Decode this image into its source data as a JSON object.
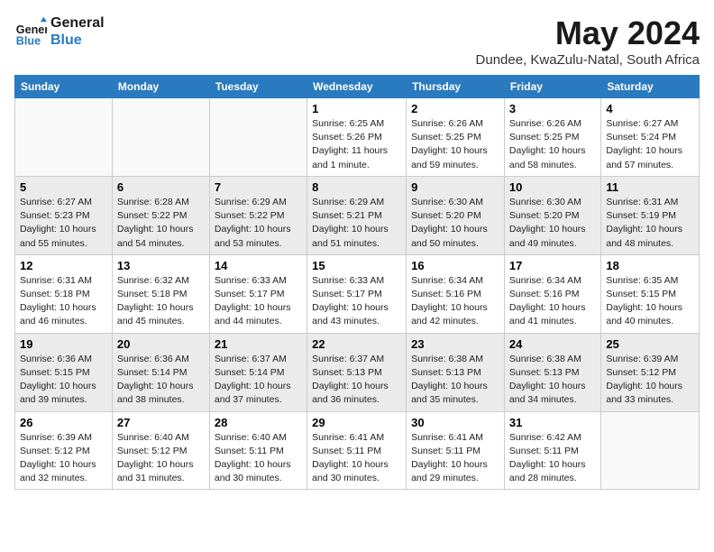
{
  "logo": {
    "line1": "General",
    "line2": "Blue"
  },
  "title": "May 2024",
  "subtitle": "Dundee, KwaZulu-Natal, South Africa",
  "days_of_week": [
    "Sunday",
    "Monday",
    "Tuesday",
    "Wednesday",
    "Thursday",
    "Friday",
    "Saturday"
  ],
  "weeks": [
    [
      {
        "num": "",
        "sunrise": "",
        "sunset": "",
        "daylight": ""
      },
      {
        "num": "",
        "sunrise": "",
        "sunset": "",
        "daylight": ""
      },
      {
        "num": "",
        "sunrise": "",
        "sunset": "",
        "daylight": ""
      },
      {
        "num": "1",
        "sunrise": "6:25 AM",
        "sunset": "5:26 PM",
        "daylight": "11 hours and 1 minute."
      },
      {
        "num": "2",
        "sunrise": "6:26 AM",
        "sunset": "5:25 PM",
        "daylight": "10 hours and 59 minutes."
      },
      {
        "num": "3",
        "sunrise": "6:26 AM",
        "sunset": "5:25 PM",
        "daylight": "10 hours and 58 minutes."
      },
      {
        "num": "4",
        "sunrise": "6:27 AM",
        "sunset": "5:24 PM",
        "daylight": "10 hours and 57 minutes."
      }
    ],
    [
      {
        "num": "5",
        "sunrise": "6:27 AM",
        "sunset": "5:23 PM",
        "daylight": "10 hours and 55 minutes."
      },
      {
        "num": "6",
        "sunrise": "6:28 AM",
        "sunset": "5:22 PM",
        "daylight": "10 hours and 54 minutes."
      },
      {
        "num": "7",
        "sunrise": "6:29 AM",
        "sunset": "5:22 PM",
        "daylight": "10 hours and 53 minutes."
      },
      {
        "num": "8",
        "sunrise": "6:29 AM",
        "sunset": "5:21 PM",
        "daylight": "10 hours and 51 minutes."
      },
      {
        "num": "9",
        "sunrise": "6:30 AM",
        "sunset": "5:20 PM",
        "daylight": "10 hours and 50 minutes."
      },
      {
        "num": "10",
        "sunrise": "6:30 AM",
        "sunset": "5:20 PM",
        "daylight": "10 hours and 49 minutes."
      },
      {
        "num": "11",
        "sunrise": "6:31 AM",
        "sunset": "5:19 PM",
        "daylight": "10 hours and 48 minutes."
      }
    ],
    [
      {
        "num": "12",
        "sunrise": "6:31 AM",
        "sunset": "5:18 PM",
        "daylight": "10 hours and 46 minutes."
      },
      {
        "num": "13",
        "sunrise": "6:32 AM",
        "sunset": "5:18 PM",
        "daylight": "10 hours and 45 minutes."
      },
      {
        "num": "14",
        "sunrise": "6:33 AM",
        "sunset": "5:17 PM",
        "daylight": "10 hours and 44 minutes."
      },
      {
        "num": "15",
        "sunrise": "6:33 AM",
        "sunset": "5:17 PM",
        "daylight": "10 hours and 43 minutes."
      },
      {
        "num": "16",
        "sunrise": "6:34 AM",
        "sunset": "5:16 PM",
        "daylight": "10 hours and 42 minutes."
      },
      {
        "num": "17",
        "sunrise": "6:34 AM",
        "sunset": "5:16 PM",
        "daylight": "10 hours and 41 minutes."
      },
      {
        "num": "18",
        "sunrise": "6:35 AM",
        "sunset": "5:15 PM",
        "daylight": "10 hours and 40 minutes."
      }
    ],
    [
      {
        "num": "19",
        "sunrise": "6:36 AM",
        "sunset": "5:15 PM",
        "daylight": "10 hours and 39 minutes."
      },
      {
        "num": "20",
        "sunrise": "6:36 AM",
        "sunset": "5:14 PM",
        "daylight": "10 hours and 38 minutes."
      },
      {
        "num": "21",
        "sunrise": "6:37 AM",
        "sunset": "5:14 PM",
        "daylight": "10 hours and 37 minutes."
      },
      {
        "num": "22",
        "sunrise": "6:37 AM",
        "sunset": "5:13 PM",
        "daylight": "10 hours and 36 minutes."
      },
      {
        "num": "23",
        "sunrise": "6:38 AM",
        "sunset": "5:13 PM",
        "daylight": "10 hours and 35 minutes."
      },
      {
        "num": "24",
        "sunrise": "6:38 AM",
        "sunset": "5:13 PM",
        "daylight": "10 hours and 34 minutes."
      },
      {
        "num": "25",
        "sunrise": "6:39 AM",
        "sunset": "5:12 PM",
        "daylight": "10 hours and 33 minutes."
      }
    ],
    [
      {
        "num": "26",
        "sunrise": "6:39 AM",
        "sunset": "5:12 PM",
        "daylight": "10 hours and 32 minutes."
      },
      {
        "num": "27",
        "sunrise": "6:40 AM",
        "sunset": "5:12 PM",
        "daylight": "10 hours and 31 minutes."
      },
      {
        "num": "28",
        "sunrise": "6:40 AM",
        "sunset": "5:11 PM",
        "daylight": "10 hours and 30 minutes."
      },
      {
        "num": "29",
        "sunrise": "6:41 AM",
        "sunset": "5:11 PM",
        "daylight": "10 hours and 30 minutes."
      },
      {
        "num": "30",
        "sunrise": "6:41 AM",
        "sunset": "5:11 PM",
        "daylight": "10 hours and 29 minutes."
      },
      {
        "num": "31",
        "sunrise": "6:42 AM",
        "sunset": "5:11 PM",
        "daylight": "10 hours and 28 minutes."
      },
      {
        "num": "",
        "sunrise": "",
        "sunset": "",
        "daylight": ""
      }
    ]
  ]
}
